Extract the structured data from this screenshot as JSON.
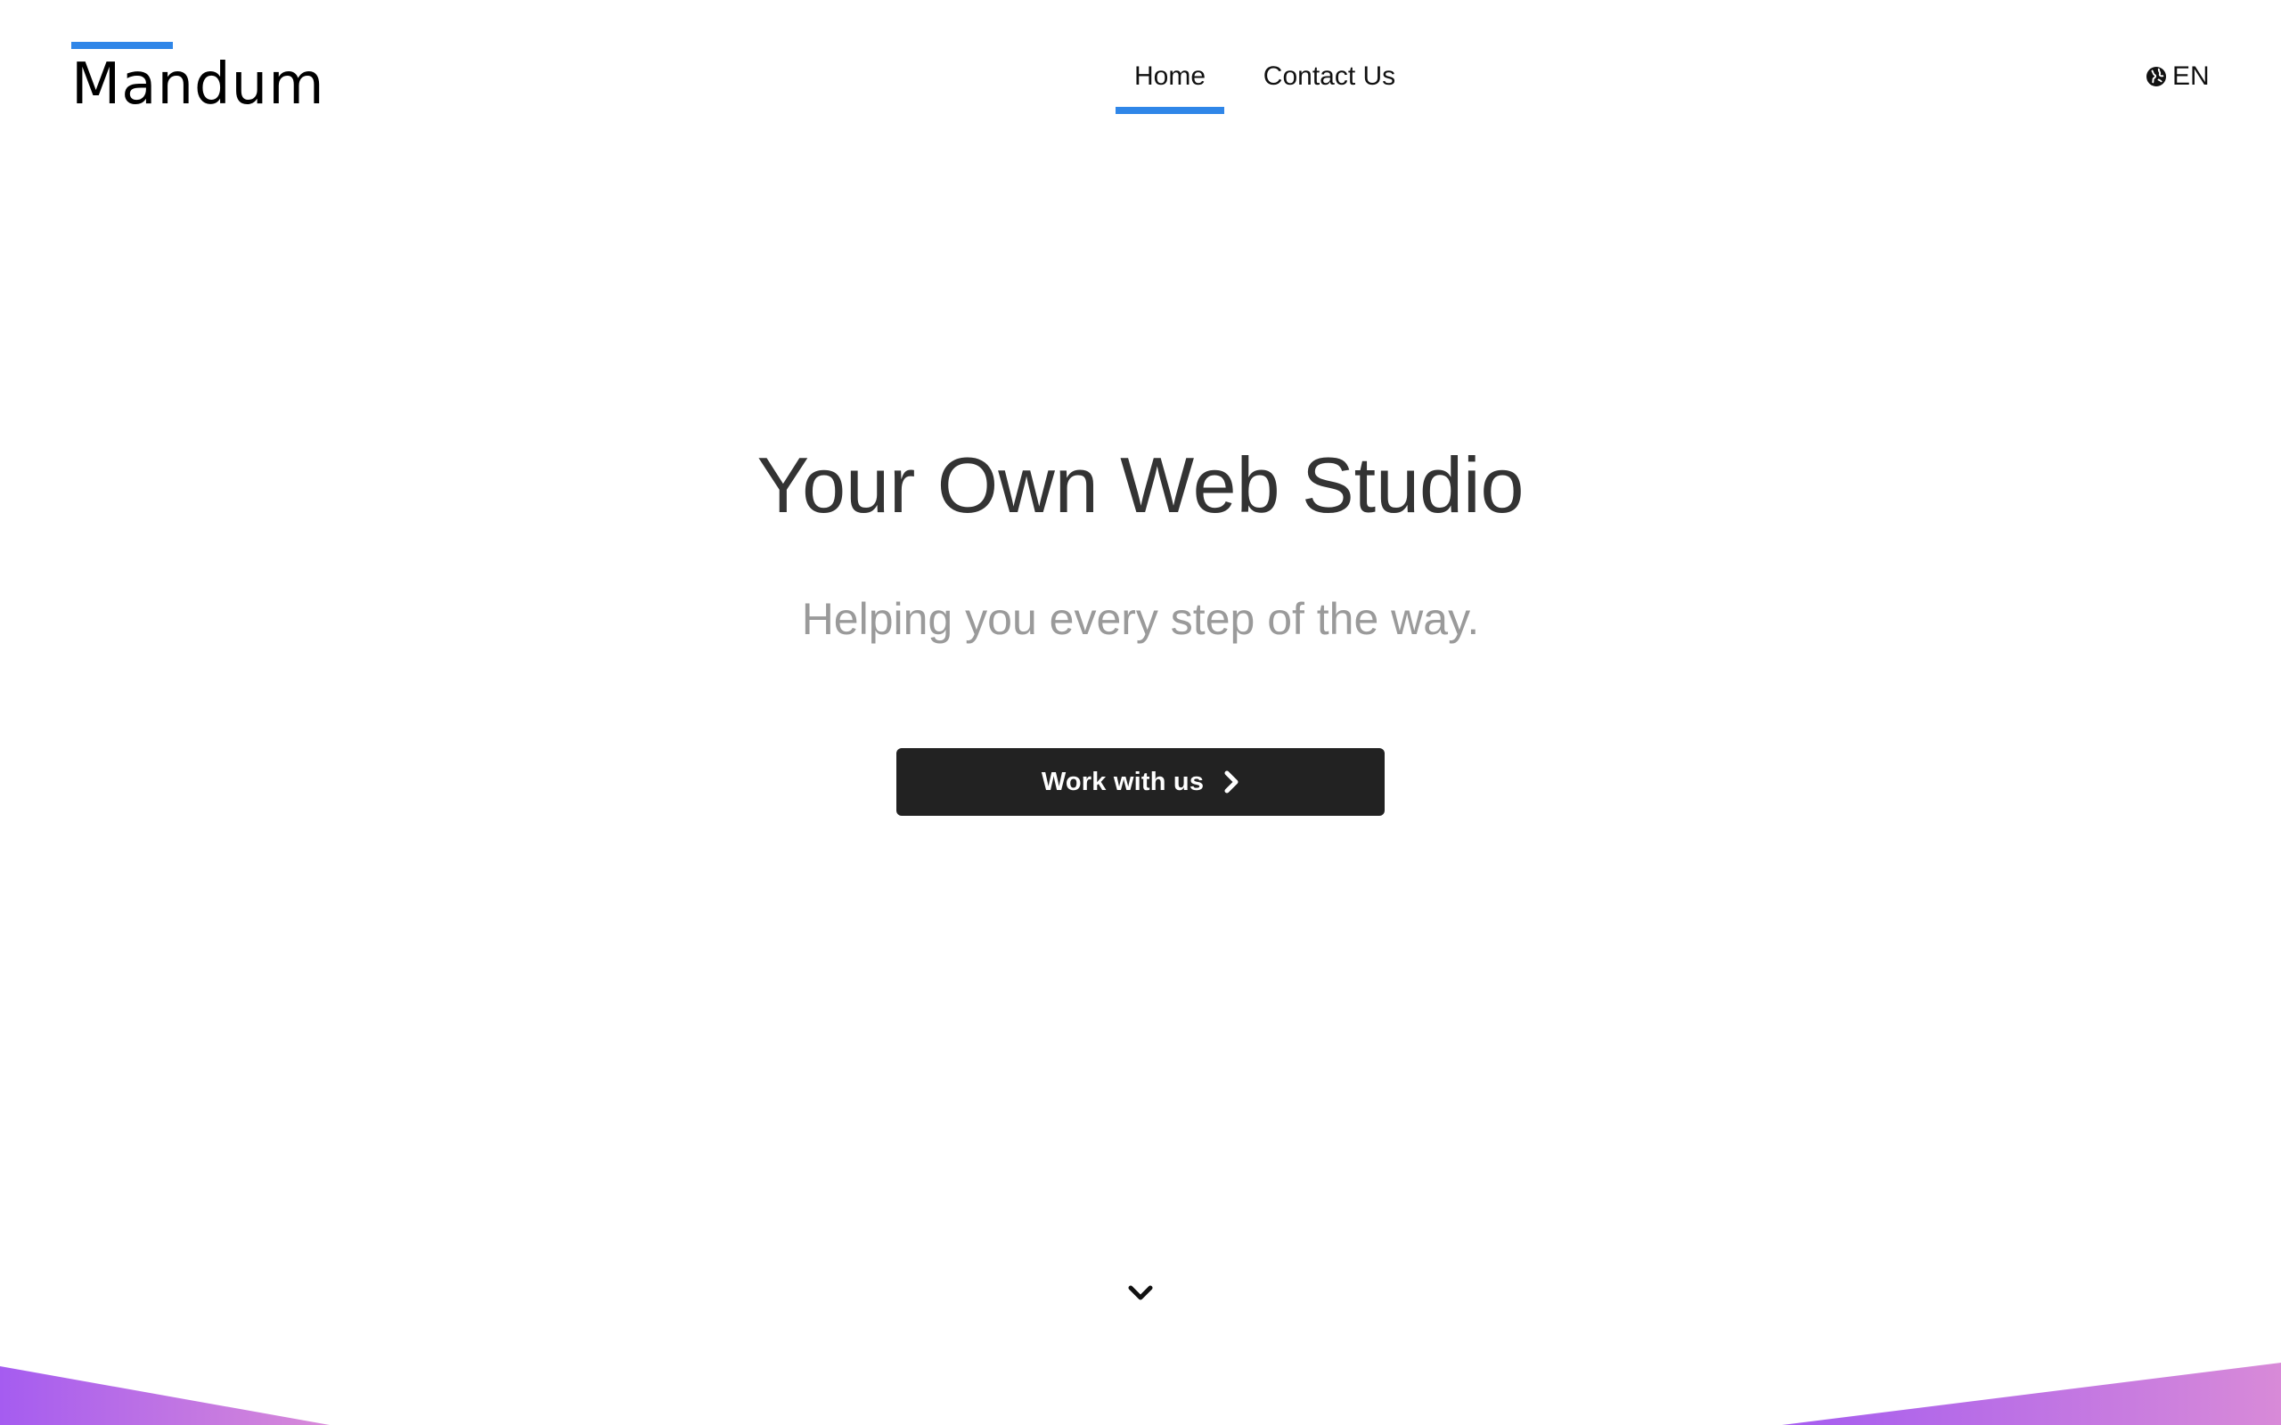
{
  "header": {
    "logo_text": "Mandum",
    "nav": {
      "home_label": "Home",
      "contact_label": "Contact Us"
    },
    "language_label": "EN"
  },
  "hero": {
    "title": "Your Own Web Studio",
    "subtitle": "Helping you every step of the way.",
    "cta_label": "Work with us"
  },
  "icons": {
    "globe": "globe-icon",
    "cta_arrow": "chevron-right-icon",
    "scroll": "chevron-down-icon"
  },
  "colors": {
    "accent": "#2f86e8",
    "button_bg": "#222222",
    "title_text": "#333333",
    "subtitle_text": "#9a9a9a",
    "gradient_left": "#a55cf0",
    "gradient_right": "#d88ad8"
  }
}
